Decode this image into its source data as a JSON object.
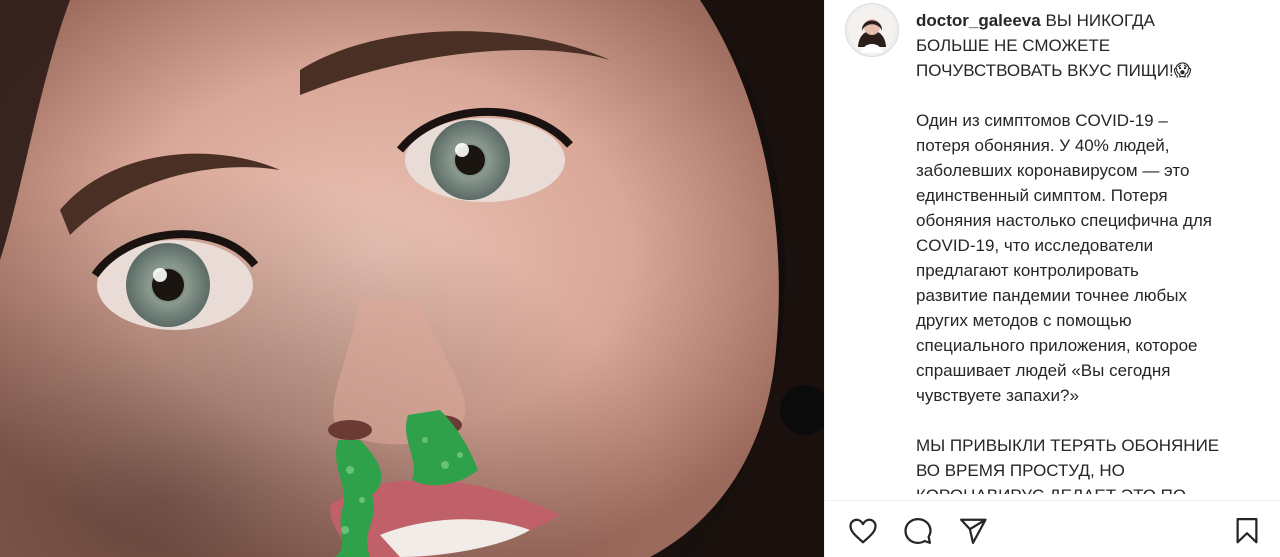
{
  "post": {
    "username": "doctor_galeeva",
    "caption_intro": " ВЫ НИКОГДА\nБОЛЬШЕ НЕ СМОЖЕТЕ\nПОЧУВСТВОВАТЬ ВКУС ПИЩИ!😱",
    "paragraph_1": "Один из симптомов COVID-19 –\nпотеря обоняния. У 40% людей,\nзаболевших коронавирусом — это\nединственный симптом. Потеря\nобоняния настолько специфична для\nCOVID-19, что исследователи\nпредлагают контролировать\nразвитие пандемии точнее любых\nдругих методов с помощью\nспециального приложения, которое\nспрашивает людей «Вы сегодня\nчувствуете запахи?»",
    "paragraph_2": "МЫ ПРИВЫКЛИ ТЕРЯТЬ ОБОНЯНИЕ\nВО ВРЕМЯ ПРОСТУД, НО\nКОРОНАВИРУС ДЕЛАЕТ ЭТО ПО"
  },
  "actions": {
    "like_icon": "heart-icon",
    "comment_icon": "comment-icon",
    "share_icon": "paper-plane-icon",
    "save_icon": "bookmark-icon"
  },
  "colors": {
    "text": "#262626",
    "border": "#efefef",
    "glitter": "#2fa14a"
  }
}
